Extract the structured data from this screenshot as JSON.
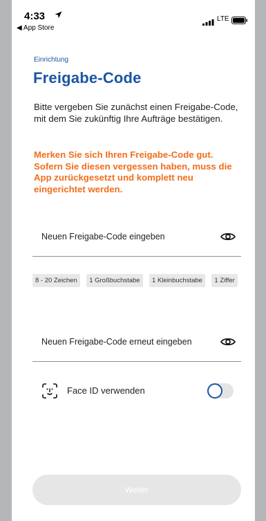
{
  "status_bar": {
    "time": "4:33",
    "back_label": "◀ App Store",
    "network": "LTE"
  },
  "header": {
    "eyebrow": "Einrichtung",
    "title": "Freigabe-Code"
  },
  "intro_text": "Bitte vergeben Sie zunächst einen Freigabe-Code, mit dem Sie zukünftig Ihre Aufträge bestätigen.",
  "warning_text": "Merken Sie sich Ihren Freigabe-Code gut. Sofern Sie diesen vergessen haben, muss die App zurückgesetzt und komplett neu eingerichtet werden.",
  "colors": {
    "brand_blue": "#1a55a3",
    "warning_orange": "#f06e1c"
  },
  "code_input": {
    "placeholder": "Neuen Freigabe-Code eingeben",
    "value": "",
    "icon": "eye-icon"
  },
  "requirements": [
    "8 - 20 Zeichen",
    "1 Großbuchstabe",
    "1 Kleinbuchstabe",
    "1 Ziffer"
  ],
  "confirm_input": {
    "placeholder": "Neuen Freigabe-Code erneut eingeben",
    "value": "",
    "icon": "eye-icon"
  },
  "face_id": {
    "icon": "face-id-icon",
    "label": "Face ID verwenden",
    "enabled": false
  },
  "continue_button": {
    "label": "Weiter",
    "disabled": true
  }
}
